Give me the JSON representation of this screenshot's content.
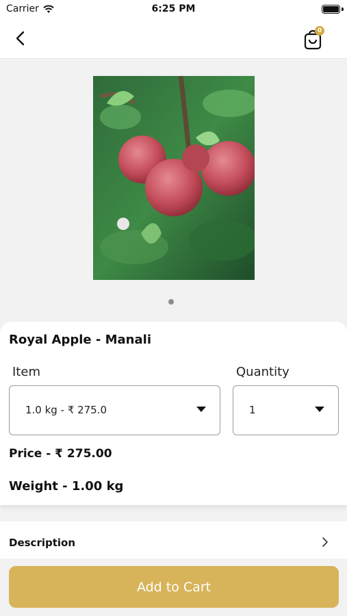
{
  "status_bar": {
    "carrier": "Carrier",
    "time": "6:25 PM"
  },
  "header": {
    "cart_count": "0",
    "icons": [
      "back-chevron-icon",
      "shopping-bag-icon"
    ]
  },
  "product": {
    "name": "Royal Apple - Manali",
    "image_icon": "apple-photo",
    "carousel_pages": 1
  },
  "options": {
    "item_label": "Item",
    "item_selected": "1.0 kg - ₹ 275.0",
    "quantity_label": "Quantity",
    "quantity_selected": "1"
  },
  "details": {
    "price": "Price - ₹ 275.00",
    "weight": "Weight - 1.00 kg"
  },
  "description": {
    "label": "Description"
  },
  "action": {
    "add_to_cart": "Add to Cart"
  },
  "colors": {
    "accent": "#d7b35a",
    "badge": "#d4ab43",
    "background": "#f2f2f2"
  }
}
